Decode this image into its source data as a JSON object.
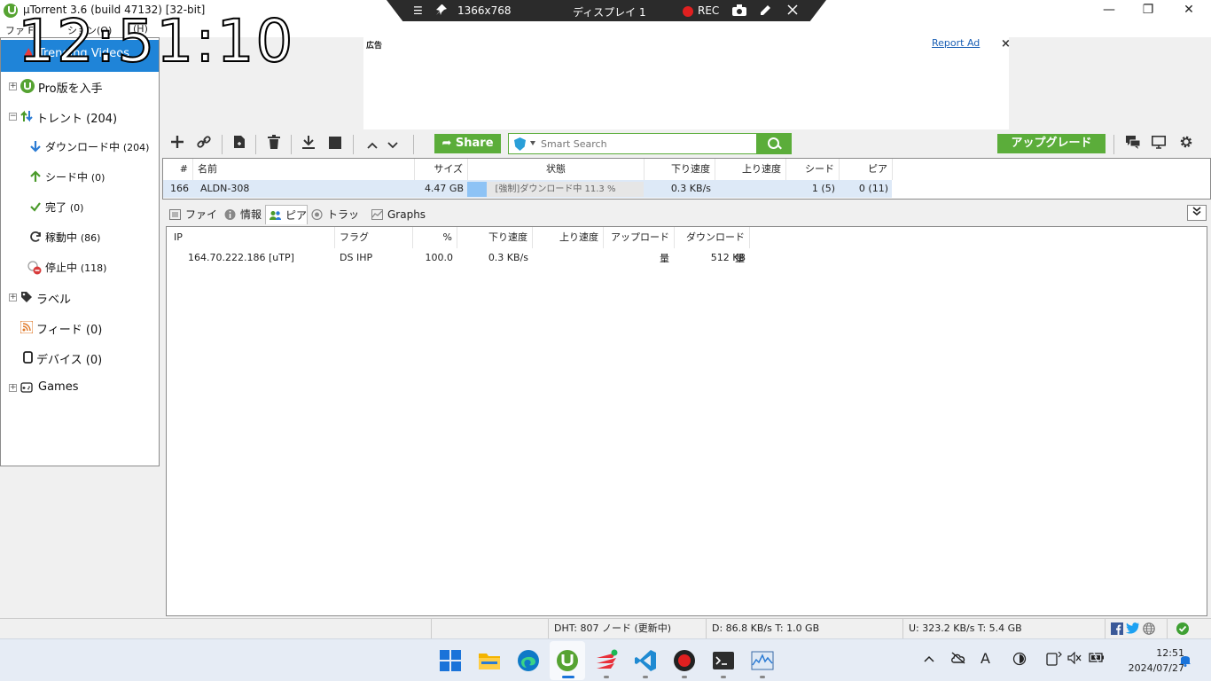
{
  "window": {
    "title": "µTorrent 3.6  (build 47132) [32-bit]",
    "minimize": "—",
    "maximize": "❐",
    "close": "✕"
  },
  "recorder": {
    "menu": "☰",
    "resolution": "1366x768",
    "display": "ディスプレイ 1",
    "rec_label": "REC"
  },
  "clock": "12:51:10",
  "menu": {
    "file": "ファ  F)",
    "options": "  ション(O)",
    "help": "    (H)"
  },
  "sidebar": {
    "trending": "Trending Videos",
    "get_pro": "Pro版を入手",
    "torrents": "トレント (204)",
    "downloading": {
      "label": "ダウンロード中",
      "count": "(204)"
    },
    "seeding": {
      "label": "シード中",
      "count": "(0)"
    },
    "completed": {
      "label": "完了",
      "count": "(0)"
    },
    "active": {
      "label": "稼動中",
      "count": "(86)"
    },
    "inactive": {
      "label": "停止中",
      "count": "(118)"
    },
    "labels": "ラベル",
    "feeds": "フィード  (0)",
    "devices": "デバイス (0)",
    "games": "Games"
  },
  "ad": {
    "label": "広告",
    "report": "Report Ad",
    "close": "×"
  },
  "toolbar": {
    "share": "Share",
    "search_placeholder": "Smart Search",
    "upgrade": "アップグレード"
  },
  "torrent_list": {
    "headers": {
      "num": "#",
      "name": "名前",
      "size": "サイズ",
      "status": "状態",
      "down_speed": "下り速度",
      "up_speed": "上り速度",
      "seeds": "シード",
      "peers": "ピア"
    },
    "rows": [
      {
        "num": "166",
        "name": "ALDN-308",
        "size": "4.47 GB",
        "status": "[強制]ダウンロード中 11.3 %",
        "progress": 0.113,
        "down_speed": "0.3 KB/s",
        "up_speed": "",
        "seeds": "1 (5)",
        "peers": "0 (11)"
      }
    ]
  },
  "detail_tabs": {
    "files": "ファイル",
    "info": "情報",
    "peers": "ピア",
    "trackers": "トラッカー",
    "graphs": "Graphs"
  },
  "peer_list": {
    "headers": {
      "ip": "IP",
      "flags": "フラグ",
      "percent": "%",
      "down_speed": "下り速度",
      "up_speed": "上り速度",
      "uploaded": "アップロード量",
      "downloaded": "ダウンロード量"
    },
    "rows": [
      {
        "ip": "164.70.222.186 [uTP]",
        "flags": "DS IHP",
        "percent": "100.0",
        "down_speed": "0.3 KB/s",
        "up_speed": "",
        "uploaded": "",
        "downloaded": "512 KB"
      }
    ]
  },
  "status_bar": {
    "dht": "DHT: 807 ノード (更新中)",
    "download": "D: 86.8 KB/s T: 1.0 GB",
    "upload": "U: 323.2 KB/s T: 5.4 GB"
  },
  "taskbar": {
    "time": "12:51",
    "date": "2024/07/27"
  },
  "colors": {
    "accent_green": "#5bad3a",
    "selected_blue": "#1f84d8",
    "progress_blue": "#8ec3f5"
  }
}
